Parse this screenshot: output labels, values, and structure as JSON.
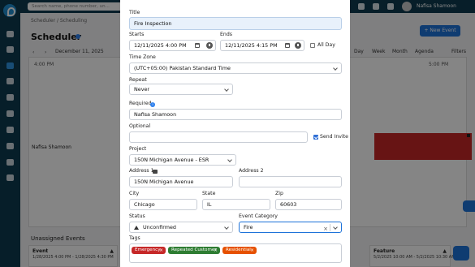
{
  "header": {
    "search_placeholder": "Search name, phone number, un...",
    "user_name": "Nafisa Shamoon"
  },
  "page": {
    "breadcrumb": "Scheduler / Scheduling",
    "title": "Scheduler",
    "new_event_label": "+ New Event",
    "date_range": "December 11, 2025",
    "views": [
      "Day",
      "Week",
      "Month",
      "Agenda"
    ],
    "filters_label": "Filters",
    "time_left": "4:00 PM",
    "time_right": "5:00 PM",
    "technician": "Nafisa Shamoon",
    "unassigned_title": "Unassigned Events",
    "unassigned_cards": [
      {
        "title": "Event",
        "dates": "1/28/2025 4:00 PM - 1/28/2025 4:30 PM"
      },
      {
        "title": "Feature",
        "dates": "5/2/2025 10:00 AM - 5/2/2025 10:30 AM"
      }
    ]
  },
  "modal": {
    "title_label": "Title",
    "title_value": "Fire Inspection",
    "starts_label": "Starts",
    "starts_date": "12/11/2025 4:00 PM",
    "ends_label": "Ends",
    "ends_date": "12/11/2025 4:15 PM",
    "all_day_label": "All Day",
    "all_day_checked": false,
    "timezone_label": "Time Zone",
    "timezone_value": "(UTC+05:00) Pakistan Standard Time",
    "repeat_label": "Repeat",
    "repeat_value": "Never",
    "required_label": "Required",
    "required_value": "Nafisa Shamoon",
    "optional_label": "Optional",
    "optional_value": "",
    "send_invite_label": "Send Invite",
    "send_invite_checked": true,
    "project_label": "Project",
    "project_value": "150N Michigan Avenue - ESR",
    "address1_label": "Address 1",
    "address1_value": "150N Michigan Avenue",
    "address2_label": "Address 2",
    "address2_value": "",
    "city_label": "City",
    "city_value": "Chicago",
    "state_label": "State",
    "state_value": "IL",
    "zip_label": "Zip",
    "zip_value": "60603",
    "status_label": "Status",
    "status_value": "Unconfirmed",
    "event_category_label": "Event Category",
    "event_category_value": "Fire",
    "tags_label": "Tags",
    "tags": [
      {
        "label": "Emergency",
        "color": "#c62828"
      },
      {
        "label": "Repeated Customer",
        "color": "#2e7d32"
      },
      {
        "label": "Residential",
        "color": "#e65100"
      }
    ]
  },
  "colors": {
    "accent": "#1e73d9",
    "sidebar": "#0d3a4f"
  }
}
